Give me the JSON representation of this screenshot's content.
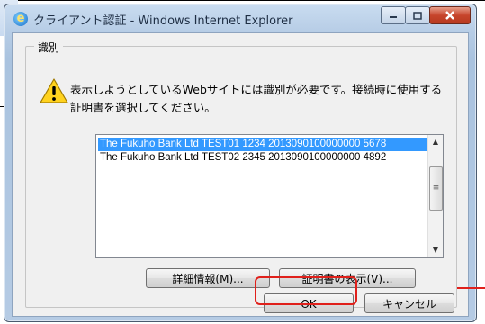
{
  "window": {
    "title": "クライアント認証 - Windows Internet Explorer",
    "app_icon": "ie-icon",
    "caption_buttons": {
      "minimize_icon": "minimize-icon",
      "maximize_icon": "maximize-icon",
      "close_icon": "close-icon"
    }
  },
  "identity_group": {
    "title": "識別",
    "warning_icon": "warning-icon",
    "message_line1": "表示しようとしているWebサイトには識別が必要です。接続時に使用する",
    "message_line2": "証明書を選択してください。"
  },
  "certificates": [
    {
      "label": "The Fukuho Bank Ltd TEST01 1234 2013090100000000 5678",
      "selected": true
    },
    {
      "label": "The Fukuho Bank Ltd TEST02 2345 2013090100000000 4892",
      "selected": false
    }
  ],
  "buttons": {
    "details": "詳細情報(M)...",
    "view_certificate": "証明書の表示(V)...",
    "ok": "OK",
    "cancel": "キャンセル"
  },
  "colors": {
    "selection": "#3399ff",
    "highlight": "#e0201b"
  }
}
